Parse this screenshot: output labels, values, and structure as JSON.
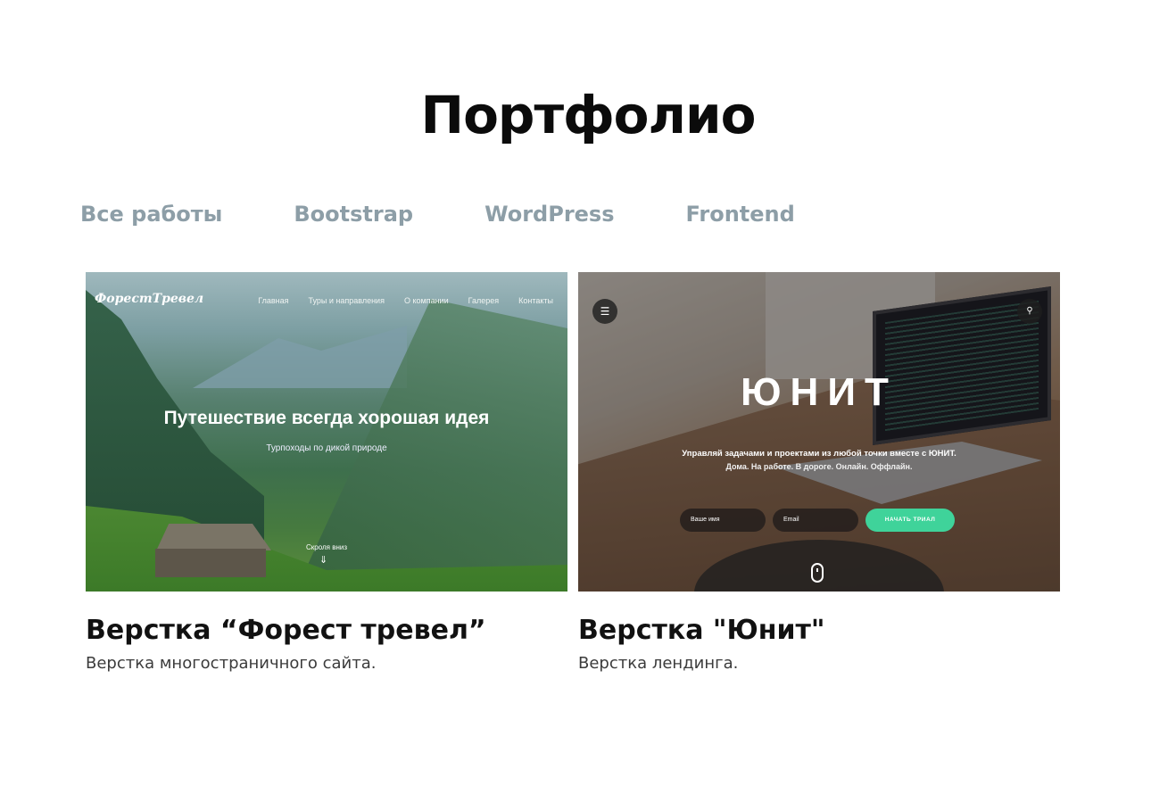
{
  "section": {
    "title": "Портфолио"
  },
  "filters": [
    {
      "label": "Все работы"
    },
    {
      "label": "Bootstrap"
    },
    {
      "label": "WordPress"
    },
    {
      "label": "Frontend"
    }
  ],
  "projects": [
    {
      "title": "Верстка “Форест тревел”",
      "description": "Верстка многостраничного сайта.",
      "preview": {
        "logo": "ФорестТревел",
        "nav": [
          "Главная",
          "Туры и направления",
          "О компании",
          "Галерея",
          "Контакты"
        ],
        "headline": "Путешествие всегда хорошая идея",
        "subheadline": "Турпоходы по дикой природе",
        "scroll_label": "Скроля вниз"
      }
    },
    {
      "title": "Верстка \"Юнит\"",
      "description": "Верстка лендинга.",
      "preview": {
        "headline": "ЮНИТ",
        "subheadline_1": "Управляй задачами и проектами из любой точки вместе с ЮНИТ.",
        "subheadline_2": "Дома. На работе. В дороге. Онлайн. Оффлайн.",
        "name_placeholder": "Ваше имя",
        "email_placeholder": "Email",
        "cta_label": "НАЧАТЬ ТРИАЛ"
      }
    }
  ],
  "colors": {
    "title_highlight": "#f8dc62",
    "filter_text": "#8d9ea7",
    "cta_green": "#3fd39a"
  },
  "icons": [
    "menu-icon",
    "search-icon",
    "chevron-down-icon",
    "mouse-scroll-icon"
  ]
}
